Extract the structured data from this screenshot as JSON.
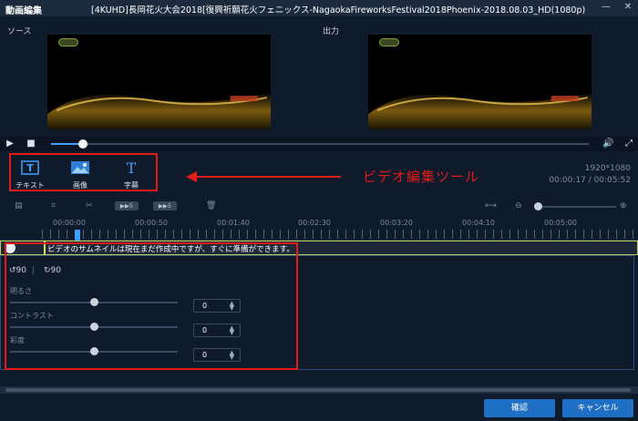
{
  "window": {
    "app_title": "動画編集",
    "file_title": "[4KUHD]長岡花火大会2018[復興祈願花火フェニックス-NagaokaFireworksFestival2018Phoenix-2018.08.03_HD(1080p)"
  },
  "preview": {
    "source_label": "ソース",
    "output_label": "出力"
  },
  "tools": {
    "items": [
      {
        "label": "テキスト",
        "icon": "text-box-icon"
      },
      {
        "label": "画像",
        "icon": "image-icon"
      },
      {
        "label": "字幕",
        "icon": "text-t-icon"
      }
    ],
    "annotation": "ビデオ編集ツール",
    "highlight_color": "#e21b1b"
  },
  "info": {
    "resolution": "1920*1080",
    "time": "00:00:17 / 00:05:52"
  },
  "toolbar": {
    "chip1": "▶▶5",
    "chip2": "▶▶5"
  },
  "ruler": {
    "labels": [
      "00:00:00",
      "00:00:50",
      "00:01:40",
      "00:02:30",
      "00:03:20",
      "00:04:10",
      "00:05:00"
    ]
  },
  "track": {
    "message": "ビデオのサムネイルは現在まだ作成中ですが、すぐに準備ができます。"
  },
  "adjust": {
    "rotate_left": "90",
    "rotate_right": "90",
    "rows": [
      {
        "label": "明るさ",
        "value": "0",
        "level": 0.5
      },
      {
        "label": "コントラスト",
        "value": "0",
        "level": 0.5
      },
      {
        "label": "彩度",
        "value": "0",
        "level": 0.5
      }
    ]
  },
  "playback": {
    "progress": 0.048
  },
  "footer": {
    "confirm_label": "確認",
    "cancel_label": "キャンセル"
  },
  "colors": {
    "background": "#0f1b2b",
    "accent": "#1f6fc4",
    "annotation_red": "#e21b1b"
  }
}
